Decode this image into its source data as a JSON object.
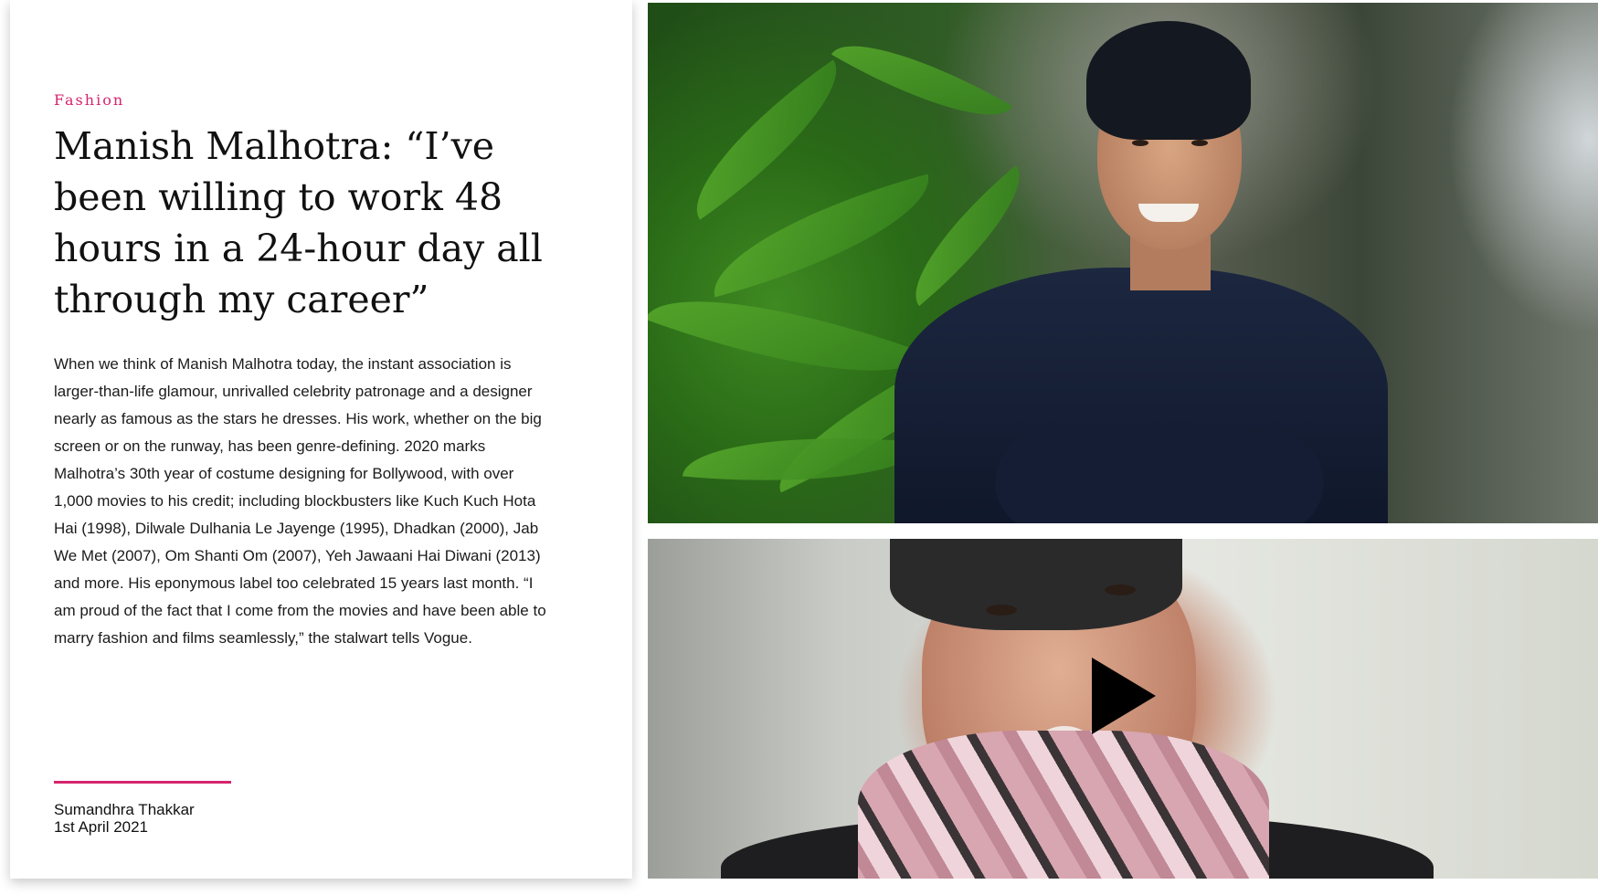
{
  "article": {
    "category": "Fashion",
    "headline": "Manish Malhotra: “I’ve been willing to work 48 hours in a 24-hour day all through my career”",
    "body": "When we think of Manish Malhotra today, the instant association is larger-than-life glamour, unrivalled celebrity patronage and a designer nearly as famous as the stars he dresses. His work, whether on the big screen or on the runway, has been genre-defining. 2020 marks Malhotra’s 30th year of costume designing for Bollywood, with over 1,000 movies to his credit; including blockbusters like Kuch Kuch Hota Hai (1998), Dilwale Dulhania Le Jayenge (1995), Dhadkan (2000), Jab We Met (2007), Om Shanti Om (2007), Yeh Jawaani Hai Diwani (2013) and more. His eponymous label too celebrated 15 years last month. “I am proud of the fact that I come from the movies and have been able to marry fashion and films seamlessly,” the stalwart tells Vogue.",
    "author": "Sumandhra Thakkar",
    "date": "1st April 2021"
  },
  "colors": {
    "accent": "#d6246e",
    "text": "#111111",
    "background": "#ffffff"
  },
  "media": {
    "video_icon": "play-icon"
  }
}
